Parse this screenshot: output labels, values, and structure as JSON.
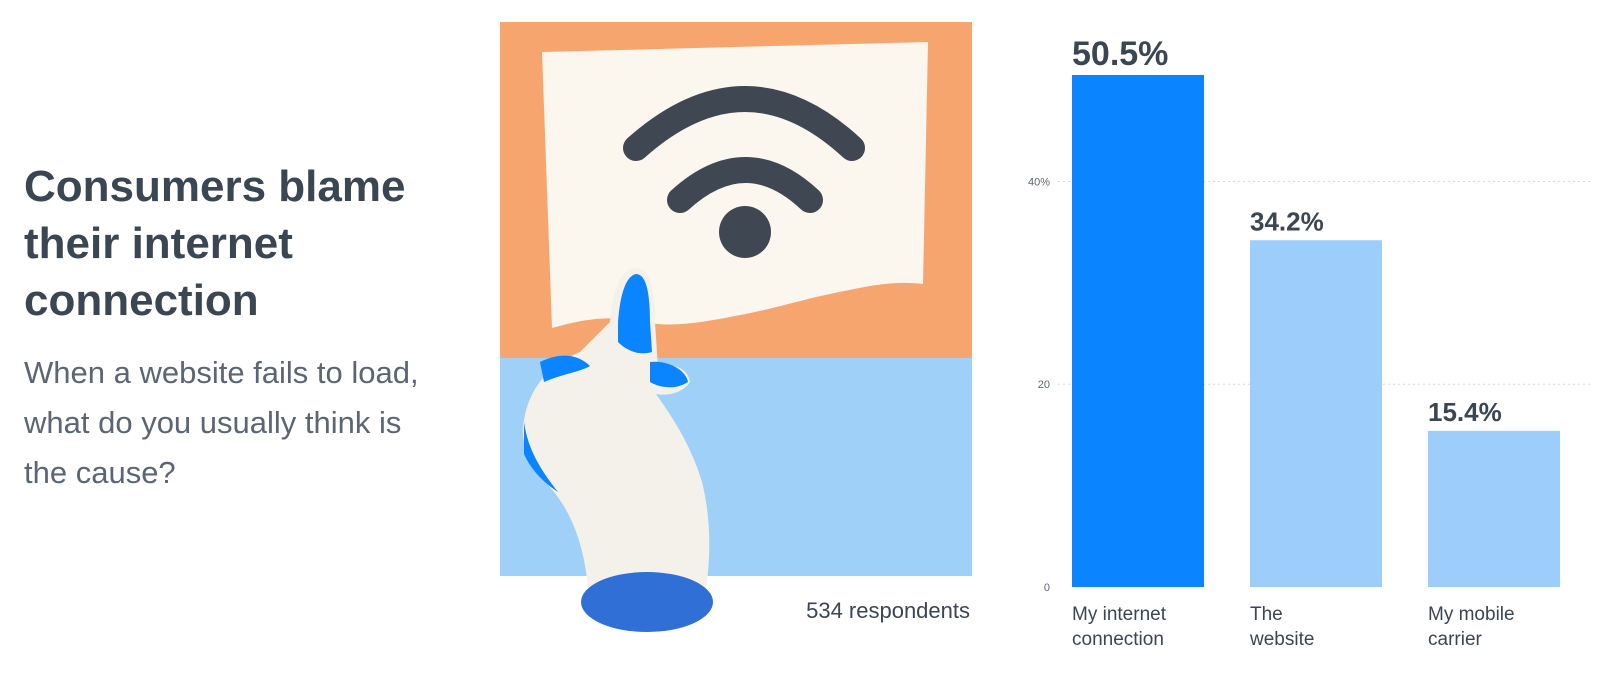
{
  "heading": {
    "title": "Consumers blame their internet connection",
    "subtitle": "When a website fails to load, what do you usually think is the cause?"
  },
  "respondents": "534 respondents",
  "colors": {
    "highlight_bar": "#0a84ff",
    "bar": "#9dcdfa",
    "illustration_top": "#f7a56f",
    "illustration_bottom": "#9fd0f8"
  },
  "chart_data": {
    "type": "bar",
    "categories": [
      [
        "My internet",
        "connection"
      ],
      [
        "The",
        "website"
      ],
      [
        "My mobile",
        "carrier"
      ]
    ],
    "values": [
      50.5,
      34.2,
      15.4
    ],
    "data_labels": [
      "50.5%",
      "34.2%",
      "15.4%"
    ],
    "highlight_index": 0,
    "yticks": [
      0,
      20,
      40
    ],
    "ytick_labels": [
      "0",
      "20",
      "40%"
    ],
    "ylim": [
      0,
      50.5
    ],
    "grid": true,
    "title": "",
    "xlabel": "",
    "ylabel": ""
  }
}
